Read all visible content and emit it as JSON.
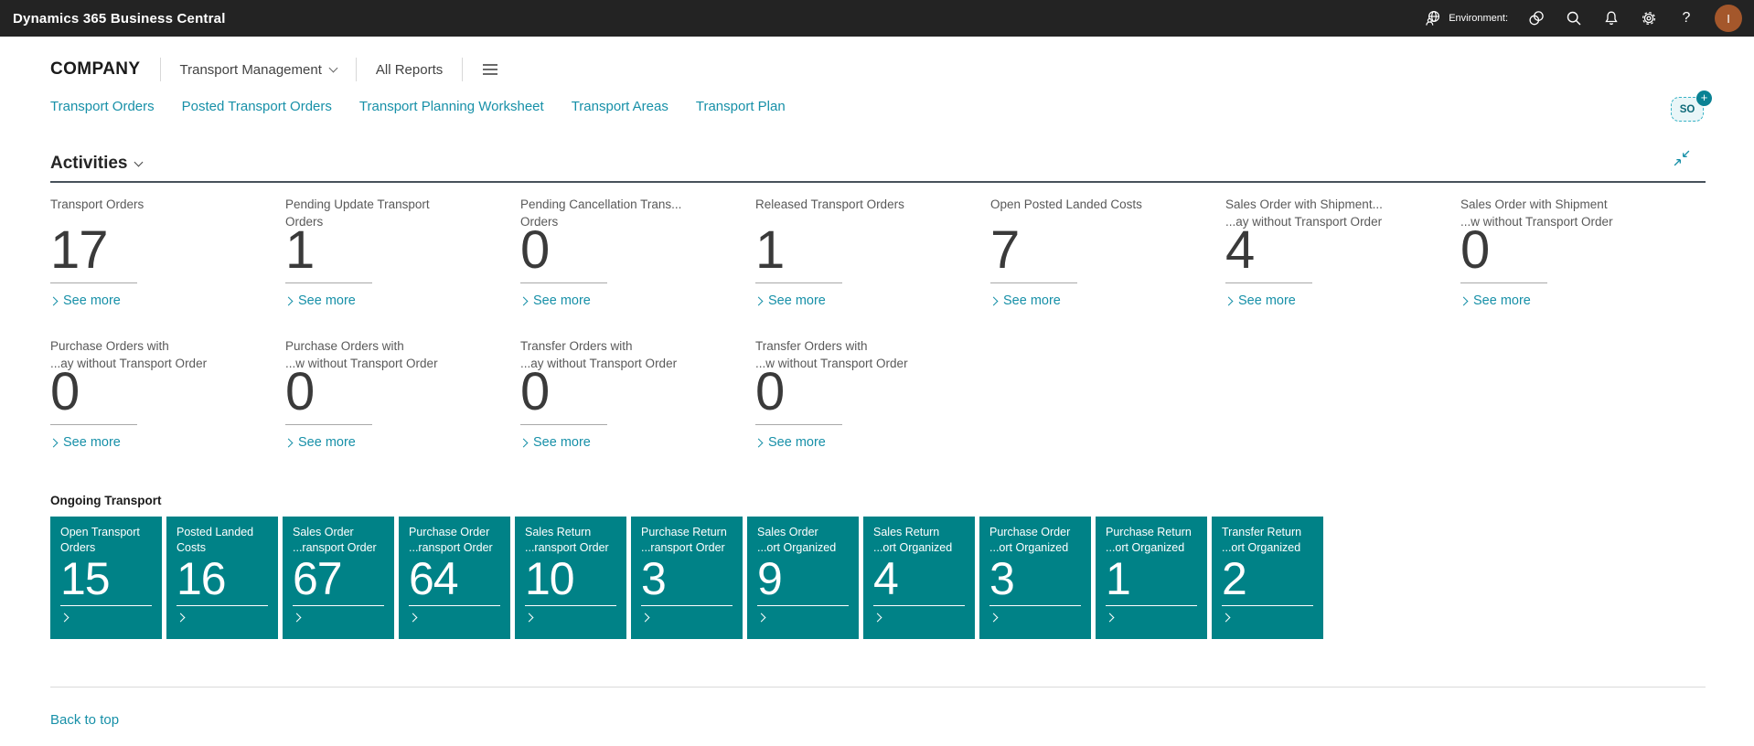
{
  "colors": {
    "accent": "#1790a8",
    "tile_bg": "#008287",
    "topbar_bg": "#232323",
    "avatar_bg": "#a4572b"
  },
  "topbar": {
    "title": "Dynamics 365 Business Central",
    "environment_label": "Environment:",
    "avatar_initial": "I",
    "icons": {
      "environment": "person-globe",
      "apps": "overlapping-circles",
      "search": "magnifier",
      "notifications": "bell",
      "settings": "gear",
      "help": "question-mark"
    }
  },
  "header": {
    "company": "COMPANY",
    "role_switcher": "Transport Management",
    "all_reports": "All Reports",
    "badge_text": "SO",
    "badge_plus": "+"
  },
  "nav": {
    "items": [
      {
        "label": "Transport Orders"
      },
      {
        "label": "Posted Transport Orders"
      },
      {
        "label": "Transport Planning Worksheet"
      },
      {
        "label": "Transport Areas"
      },
      {
        "label": "Transport Plan"
      }
    ]
  },
  "activities": {
    "title": "Activities",
    "see_more": "See more",
    "cues": [
      {
        "line1": "Transport Orders",
        "line2": "",
        "value": "17"
      },
      {
        "line1": "Pending Update Transport",
        "line2": "Orders",
        "value": "1"
      },
      {
        "line1": "Pending Cancellation Trans...",
        "line2": "Orders",
        "value": "0"
      },
      {
        "line1": "Released Transport Orders",
        "line2": "",
        "value": "1"
      },
      {
        "line1": "Open Posted Landed Costs",
        "line2": "",
        "value": "7"
      },
      {
        "line1": "Sales Order with Shipment...",
        "line2": "...ay without Transport Order",
        "value": "4"
      },
      {
        "line1": "Sales Order with Shipment",
        "line2": "...w without Transport Order",
        "value": "0"
      },
      {
        "line1": "Purchase Orders with",
        "line2": "...ay without Transport Order",
        "value": "0"
      },
      {
        "line1": "Purchase Orders with",
        "line2": "...w without Transport Order",
        "value": "0"
      },
      {
        "line1": "Transfer Orders with",
        "line2": "...ay without Transport Order",
        "value": "0"
      },
      {
        "line1": "Transfer Orders with",
        "line2": "...w without Transport Order",
        "value": "0"
      }
    ]
  },
  "ongoing": {
    "title": "Ongoing Transport",
    "tiles": [
      {
        "line1": "Open Transport",
        "line2": "Orders",
        "value": "15"
      },
      {
        "line1": "Posted Landed",
        "line2": "Costs",
        "value": "16"
      },
      {
        "line1": "Sales Order",
        "line2": "...ransport Order",
        "value": "67"
      },
      {
        "line1": "Purchase Order",
        "line2": "...ransport Order",
        "value": "64"
      },
      {
        "line1": "Sales Return",
        "line2": "...ransport Order",
        "value": "10"
      },
      {
        "line1": "Purchase Return",
        "line2": "...ransport Order",
        "value": "3"
      },
      {
        "line1": "Sales Order",
        "line2": "...ort Organized",
        "value": "9"
      },
      {
        "line1": "Sales Return",
        "line2": "...ort Organized",
        "value": "4"
      },
      {
        "line1": "Purchase Order",
        "line2": "...ort Organized",
        "value": "3"
      },
      {
        "line1": "Purchase Return",
        "line2": "...ort Organized",
        "value": "1"
      },
      {
        "line1": "Transfer Return",
        "line2": "...ort Organized",
        "value": "2"
      }
    ]
  },
  "footer": {
    "back_to_top": "Back to top"
  }
}
